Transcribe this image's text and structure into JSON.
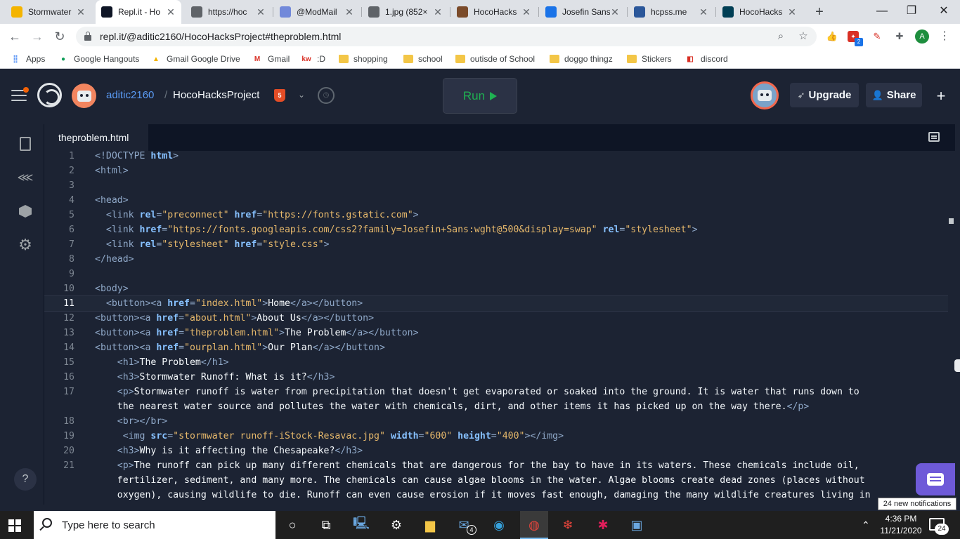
{
  "browser": {
    "tabs": [
      {
        "title": "Stormwater",
        "favicon": "stormwater-favicon",
        "color": "#f4b400"
      },
      {
        "title": "Repl.it - Ho",
        "favicon": "replit-favicon",
        "color": "#0e1525",
        "active": true
      },
      {
        "title": "https://hoc",
        "favicon": "globe-favicon",
        "color": "#5f6368"
      },
      {
        "title": "@ModMail",
        "favicon": "discord-favicon",
        "color": "#7289da"
      },
      {
        "title": "1.jpg (852×",
        "favicon": "image-favicon",
        "color": "#5f6368"
      },
      {
        "title": "HocoHacks",
        "favicon": "hocohacks-favicon",
        "color": "#7b4b2a"
      },
      {
        "title": "Josefin Sans",
        "favicon": "google-fonts-favicon",
        "color": "#1a73e8"
      },
      {
        "title": "hcpss.me",
        "favicon": "hcpss-favicon",
        "color": "#2b579a"
      },
      {
        "title": "HocoHacks",
        "favicon": "devpost-favicon",
        "color": "#003e54"
      }
    ],
    "url": "repl.it/@aditic2160/HocoHacksProject#theproblem.html",
    "profile_initial": "A",
    "ext_badge": "2"
  },
  "bookmarks": [
    {
      "label": "Apps",
      "icon": "apps-grid-icon"
    },
    {
      "label": "Google Hangouts",
      "icon": "hangouts-icon"
    },
    {
      "label": "Gmail Google Drive",
      "icon": "google-drive-icon"
    },
    {
      "label": "Gmail",
      "icon": "gmail-icon"
    },
    {
      "label": ":D",
      "icon": "kw-icon",
      "icon_text": "kw"
    },
    {
      "label": "shopping",
      "icon": "folder-icon"
    },
    {
      "label": "school",
      "icon": "folder-icon"
    },
    {
      "label": "outisde of School",
      "icon": "folder-icon"
    },
    {
      "label": "doggo thingz",
      "icon": "folder-icon"
    },
    {
      "label": "Stickers",
      "icon": "folder-icon"
    },
    {
      "label": "discord",
      "icon": "discord-icon"
    }
  ],
  "repl": {
    "username": "aditic2160",
    "separator": "/",
    "project": "HocoHacksProject",
    "run_label": "Run",
    "upgrade_label": "Upgrade",
    "share_label": "Share",
    "file_tab": "theproblem.html",
    "help_label": "?"
  },
  "code": {
    "cursor_line": 11,
    "lines": [
      {
        "n": "1",
        "html": "<span class='t'>&lt;!DOCTYPE </span><span class='kw'>html</span><span class='t'>&gt;</span>"
      },
      {
        "n": "2",
        "html": "<span class='t'>&lt;html&gt;</span>"
      },
      {
        "n": "3",
        "html": ""
      },
      {
        "n": "4",
        "html": "<span class='t'>&lt;head&gt;</span>"
      },
      {
        "n": "5",
        "html": "  <span class='t'>&lt;link </span><span class='a'>rel</span><span class='t'>=</span><span class='s'>\"preconnect\"</span> <span class='a'>href</span><span class='t'>=</span><span class='s'>\"https://fonts.gstatic.com\"</span><span class='t'>&gt;</span>"
      },
      {
        "n": "6",
        "html": "  <span class='t'>&lt;link </span><span class='a'>href</span><span class='t'>=</span><span class='s'>\"https://fonts.googleapis.com/css2?family=Josefin+Sans:wght@500&amp;display=swap\"</span> <span class='a'>rel</span><span class='t'>=</span><span class='s'>\"stylesheet\"</span><span class='t'>&gt;</span>"
      },
      {
        "n": "7",
        "html": "  <span class='t'>&lt;link </span><span class='a'>rel</span><span class='t'>=</span><span class='s'>\"stylesheet\"</span> <span class='a'>href</span><span class='t'>=</span><span class='s'>\"style.css\"</span><span class='t'>&gt;</span>"
      },
      {
        "n": "8",
        "html": "<span class='t'>&lt;/head&gt;</span>"
      },
      {
        "n": "9",
        "html": ""
      },
      {
        "n": "10",
        "html": "<span class='t'>&lt;body&gt;</span>"
      },
      {
        "n": "11",
        "html": "  <span class='t'>&lt;button&gt;&lt;a </span><span class='a'>href</span><span class='t'>=</span><span class='s'>\"index.html\"</span><span class='t'>&gt;</span><span class='x'>Home</span><span class='t'>&lt;/a&gt;&lt;/button&gt;</span>"
      },
      {
        "n": "12",
        "html": "<span class='t'>&lt;button&gt;&lt;a </span><span class='a'>href</span><span class='t'>=</span><span class='s'>\"about.html\"</span><span class='t'>&gt;</span><span class='x'>About Us</span><span class='t'>&lt;/a&gt;&lt;/button&gt;</span>"
      },
      {
        "n": "13",
        "html": "<span class='t'>&lt;button&gt;&lt;a </span><span class='a'>href</span><span class='t'>=</span><span class='s'>\"theproblem.html\"</span><span class='t'>&gt;</span><span class='x'>The Problem</span><span class='t'>&lt;/a&gt;&lt;/button&gt;</span>"
      },
      {
        "n": "14",
        "html": "<span class='t'>&lt;button&gt;&lt;a </span><span class='a'>href</span><span class='t'>=</span><span class='s'>\"ourplan.html\"</span><span class='t'>&gt;</span><span class='x'>Our Plan</span><span class='t'>&lt;/a&gt;&lt;/button&gt;</span>"
      },
      {
        "n": "15",
        "html": "    <span class='t'>&lt;h1&gt;</span><span class='x'>The Problem</span><span class='t'>&lt;/h1&gt;</span>"
      },
      {
        "n": "16",
        "html": "    <span class='t'>&lt;h3&gt;</span><span class='x'>Stormwater Runoff: What is it?</span><span class='t'>&lt;/h3&gt;</span>"
      },
      {
        "n": "17",
        "html": "    <span class='t'>&lt;p&gt;</span><span class='x'>Stormwater runoff is water from precipitation that doesn't get evaporated or soaked into the ground. It is water that runs down to</span>"
      },
      {
        "n": "",
        "html": "    <span class='x'>the nearest water source and pollutes the water with chemicals, dirt, and other items it has picked up on the way there.</span><span class='t'>&lt;/p&gt;</span>"
      },
      {
        "n": "18",
        "html": "    <span class='t'>&lt;br&gt;&lt;/br&gt;</span>"
      },
      {
        "n": "19",
        "html": "     <span class='t'>&lt;img </span><span class='a'>src</span><span class='t'>=</span><span class='s'>\"stormwater runoff-iStock-Resavac.jpg\"</span> <span class='a'>width</span><span class='t'>=</span><span class='s'>\"600\"</span> <span class='a'>height</span><span class='t'>=</span><span class='s'>\"400\"</span><span class='t'>&gt;&lt;/img&gt;</span>"
      },
      {
        "n": "20",
        "html": "    <span class='t'>&lt;h3&gt;</span><span class='x'>Why is it affecting the Chesapeake?</span><span class='t'>&lt;/h3&gt;</span>"
      },
      {
        "n": "21",
        "html": "    <span class='t'>&lt;p&gt;</span><span class='x'>The runoff can pick up many different chemicals that are dangerous for the bay to have in its waters. These chemicals include oil,</span>"
      },
      {
        "n": "",
        "html": "    <span class='x'>fertilizer, sediment, and many more. The chemicals can cause algae blooms in the water. Algae blooms create dead zones (places without</span>"
      },
      {
        "n": "",
        "html": "    <span class='x'>oxygen), causing wildlife to die. Runoff can even cause erosion if it moves fast enough, damaging the many wildlife creatures living in</span>"
      }
    ]
  },
  "notifications": {
    "tooltip": "24 new notifications",
    "count": "24"
  },
  "taskbar": {
    "search_placeholder": "Type here to search",
    "mail_badge": "4",
    "time": "4:36 PM",
    "date": "11/21/2020"
  }
}
